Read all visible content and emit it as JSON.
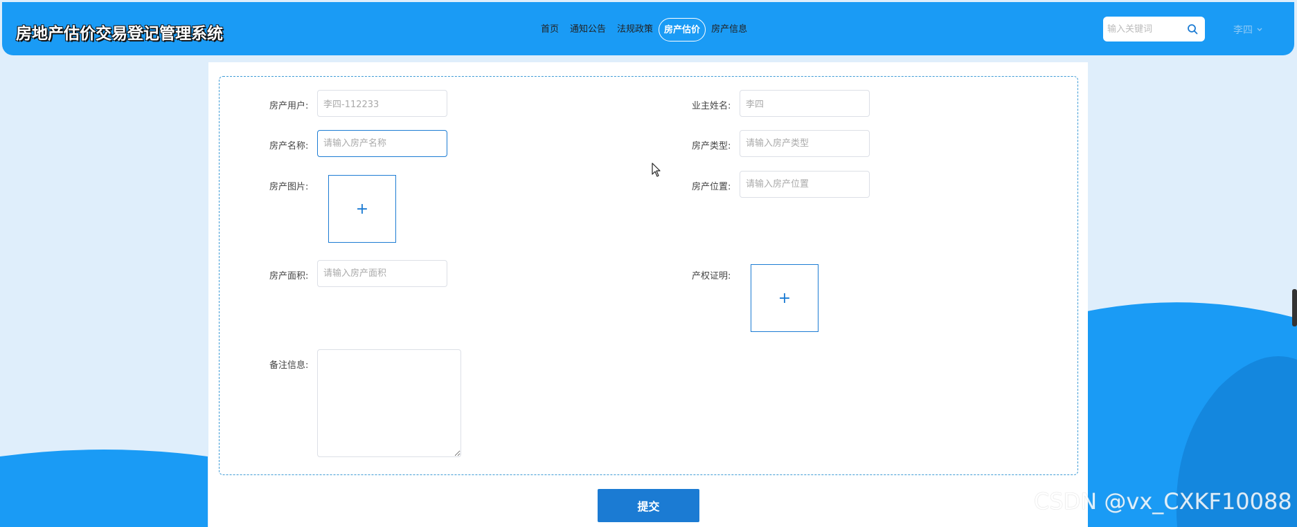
{
  "header": {
    "site_title": "房地产估价交易登记管理系统",
    "nav": [
      {
        "label": "首页",
        "active": false
      },
      {
        "label": "通知公告",
        "active": false
      },
      {
        "label": "法规政策",
        "active": false
      },
      {
        "label": "房产估价",
        "active": true
      },
      {
        "label": "房产信息",
        "active": false
      }
    ],
    "search_placeholder": "输入关键词",
    "user_name": "李四"
  },
  "form": {
    "house_user": {
      "label": "房产用户:",
      "value": "李四-112233"
    },
    "owner_name": {
      "label": "业主姓名:",
      "value": "李四"
    },
    "house_name": {
      "label": "房产名称:",
      "placeholder": "请输入房产名称"
    },
    "house_type": {
      "label": "房产类型:",
      "placeholder": "请输入房产类型"
    },
    "house_image": {
      "label": "房产图片:",
      "upload_symbol": "+"
    },
    "house_location": {
      "label": "房产位置:",
      "placeholder": "请输入房产位置"
    },
    "house_area": {
      "label": "房产面积:",
      "placeholder": "请输入房产面积"
    },
    "property_cert": {
      "label": "产权证明:",
      "upload_symbol": "+"
    },
    "remarks": {
      "label": "备注信息:"
    },
    "submit_label": "提交"
  },
  "watermark": "CSDN @vx_CXKF10088",
  "colors": {
    "header_bg": "#1a9bf5",
    "primary": "#1b7bd3",
    "page_bg": "#dfeefb"
  }
}
